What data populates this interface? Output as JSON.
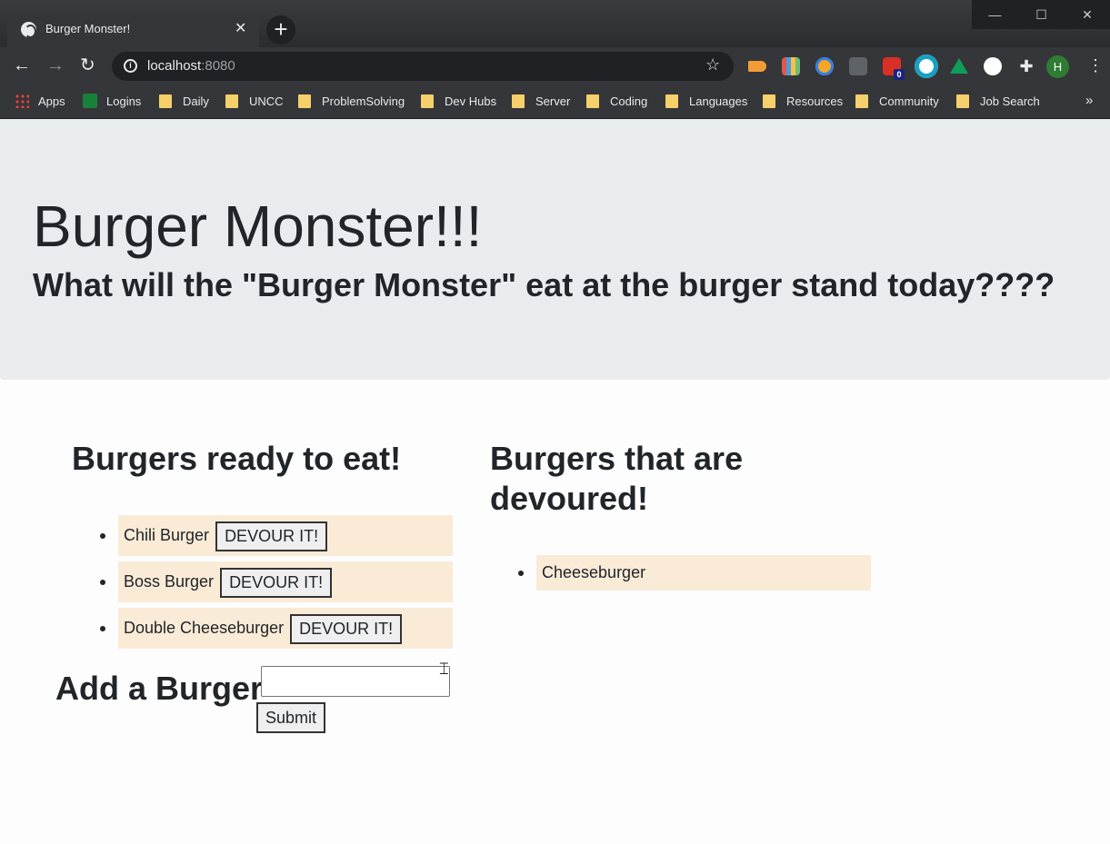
{
  "browser": {
    "tab_title": "Burger Monster!",
    "tab_close": "✕",
    "new_tab": "+",
    "window_controls": [
      "—",
      "☐",
      "✕"
    ],
    "nav": {
      "back": "←",
      "forward": "→",
      "reload": "↻"
    },
    "address": {
      "host": "localhost",
      "port": ":8080",
      "info": "i",
      "star": "☆"
    },
    "profile_initial": "H",
    "menu": "⋮",
    "bookmarks": [
      {
        "label": "Apps",
        "icon": "apps-grid-icon"
      },
      {
        "label": "Logins",
        "icon": "sheets-icon"
      },
      {
        "label": "Daily",
        "icon": "folder-icon"
      },
      {
        "label": "UNCC",
        "icon": "folder-icon"
      },
      {
        "label": "ProblemSolving",
        "icon": "folder-icon"
      },
      {
        "label": "Dev Hubs",
        "icon": "folder-icon"
      },
      {
        "label": "Server",
        "icon": "folder-icon"
      },
      {
        "label": "Coding",
        "icon": "folder-icon"
      },
      {
        "label": "Languages",
        "icon": "folder-icon"
      },
      {
        "label": "Resources",
        "icon": "folder-icon"
      },
      {
        "label": "Community",
        "icon": "folder-icon"
      },
      {
        "label": "Job Search",
        "icon": "folder-icon"
      }
    ],
    "bookmarks_more": "»",
    "extension_badge": "0"
  },
  "page": {
    "title": "Burger Monster!!!",
    "subtitle": "What will the \"Burger Monster\" eat at the burger stand today????",
    "ready_heading": "Burgers ready to eat!",
    "devoured_heading": "Burgers that are devoured!",
    "ready_burgers": [
      {
        "name": "Chili Burger",
        "button": "DEVOUR IT!"
      },
      {
        "name": "Boss Burger",
        "button": "DEVOUR IT!"
      },
      {
        "name": "Double Cheeseburger",
        "button": "DEVOUR IT!"
      }
    ],
    "devoured_burgers": [
      {
        "name": "Cheeseburger"
      }
    ],
    "add_label": "Add a Burger",
    "add_input_value": "",
    "submit_label": "Submit"
  },
  "colors": {
    "jumbotron_bg": "#e9ecef",
    "burger_item_bg": "#faebd7",
    "text": "#212529"
  }
}
